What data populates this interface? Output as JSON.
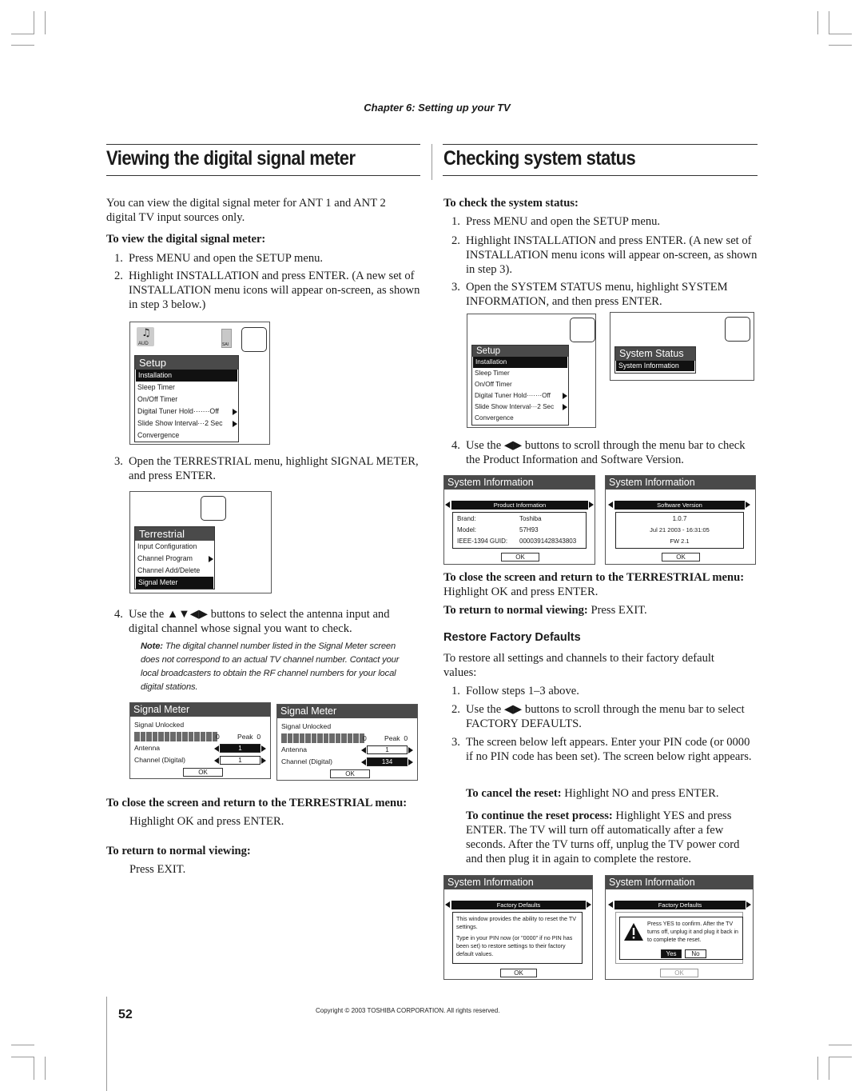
{
  "header": {
    "chapter": "Chapter 6: Setting up your TV"
  },
  "left": {
    "title": "Viewing the digital signal meter",
    "intro": "You can view the digital signal meter for ANT 1 and ANT 2 digital TV input sources only.",
    "procedure_heading": "To view the digital signal meter:",
    "steps": [
      "Press MENU and open the SETUP menu.",
      "Highlight INSTALLATION and press ENTER. (A new set of INSTALLATION menu icons will appear on-screen, as shown in step 3 below.)",
      "Open the TERRESTRIAL menu, highlight SIGNAL METER, and press ENTER.",
      "Use the ▲▼◀▶ buttons to select the antenna input and digital channel whose signal you want to check."
    ],
    "note_label": "Note:",
    "note_text": "The digital channel number listed in the Signal Meter screen does not correspond to an actual TV channel number. Contact your local broadcasters to obtain the RF channel numbers for your local digital stations.",
    "close_heading": "To close the screen and return to the TERRESTRIAL menu:",
    "close_text": "Highlight OK and press ENTER.",
    "return_heading": "To return to normal viewing:",
    "return_text": "Press EXIT."
  },
  "right": {
    "title": "Checking system status",
    "procedure_heading": "To check the system status:",
    "steps": [
      "Press MENU and open the SETUP menu.",
      "Highlight INSTALLATION and press ENTER. (A new set of INSTALLATION menu icons will appear on-screen, as shown in step 3).",
      "Open the SYSTEM STATUS menu, highlight SYSTEM INFORMATION, and then press ENTER.",
      "Use the ◀▶ buttons to scroll through the menu bar to check the Product Information and Software Version."
    ],
    "close_heading": "To close the screen and return to the TERRESTRIAL menu:",
    "close_text": "Highlight OK and press ENTER.",
    "return_heading": "To return to normal viewing:",
    "return_text": "Press EXIT.",
    "restore_heading": "Restore Factory Defaults",
    "restore_intro": "To restore all settings and channels to their factory default values:",
    "restore_steps": [
      "Follow steps 1–3 above.",
      "Use the ◀▶ buttons to scroll through the menu bar to select FACTORY DEFAULTS.",
      "The screen below left appears. Enter your PIN code (or 0000 if no PIN code has been set). The screen below right appears."
    ],
    "cancel_heading": "To cancel the reset:",
    "cancel_text": "Highlight NO and press ENTER.",
    "continue_heading": "To continue the reset process:",
    "continue_text": "Highlight YES and press ENTER. The TV will turn off automatically after a few seconds. After the TV turns off, unplug the TV power cord and then plug it in again to complete the restore."
  },
  "screens": {
    "setup_menu": {
      "title": "Setup",
      "icons": [
        "AUD",
        "SAI"
      ],
      "items": [
        "Installation",
        "Sleep Timer",
        "On/Off Timer",
        "Digital Tuner Hold·······Off",
        "Slide Show Interval···2 Sec",
        "Convergence"
      ],
      "selected": 0
    },
    "terrestrial_menu": {
      "title": "Terrestrial",
      "items": [
        "Input Configuration",
        "Channel Program",
        "Channel Add/Delete",
        "Signal Meter"
      ],
      "selected": 3
    },
    "signal_meter_a": {
      "title": "Signal Meter",
      "status": "Signal Unlocked",
      "level": "0",
      "peak": "Peak  0",
      "antenna_label": "Antenna",
      "antenna_value": "1",
      "channel_label": "Channel (Digital)",
      "channel_value": "1",
      "ok": "OK"
    },
    "signal_meter_b": {
      "title": "Signal Meter",
      "status": "Signal Unlocked",
      "level": "0",
      "peak": "Peak  0",
      "antenna_label": "Antenna",
      "antenna_value": "1",
      "channel_label": "Channel (Digital)",
      "channel_value": "134",
      "ok": "OK"
    },
    "system_status_menu": {
      "title": "System Status",
      "items": [
        "System Information"
      ]
    },
    "product_info": {
      "title": "System Information",
      "tab": "Product Information",
      "rows": [
        {
          "label": "Brand:",
          "value": "Toshiba"
        },
        {
          "label": "Model:",
          "value": "57H93"
        },
        {
          "label": "IEEE-1394 GUID:",
          "value": "0000391428343803"
        }
      ],
      "ok": "OK"
    },
    "software_version": {
      "title": "System Information",
      "tab": "Software Version",
      "lines": [
        "1.0.7",
        "Jul 21 2003 - 16:31:05",
        "FW 2.1"
      ],
      "ok": "OK"
    },
    "factory_defaults_a": {
      "title": "System Information",
      "tab": "Factory Defaults",
      "text1": "This window provides the ability to reset the TV settings.",
      "text2": "Type in your PIN now (or \"0000\" if no PIN has been set) to restore settings to their factory default values.",
      "ok": "OK"
    },
    "factory_defaults_b": {
      "title": "System Information",
      "tab": "Factory Defaults",
      "confirm": "Press YES to confirm. After the TV turns off, unplug it and plug it back in to complete the reset.",
      "yes": "Yes",
      "no": "No",
      "ok": "OK"
    }
  },
  "footer": {
    "page_number": "52",
    "copyright": "Copyright © 2003 TOSHIBA CORPORATION. All rights reserved."
  }
}
